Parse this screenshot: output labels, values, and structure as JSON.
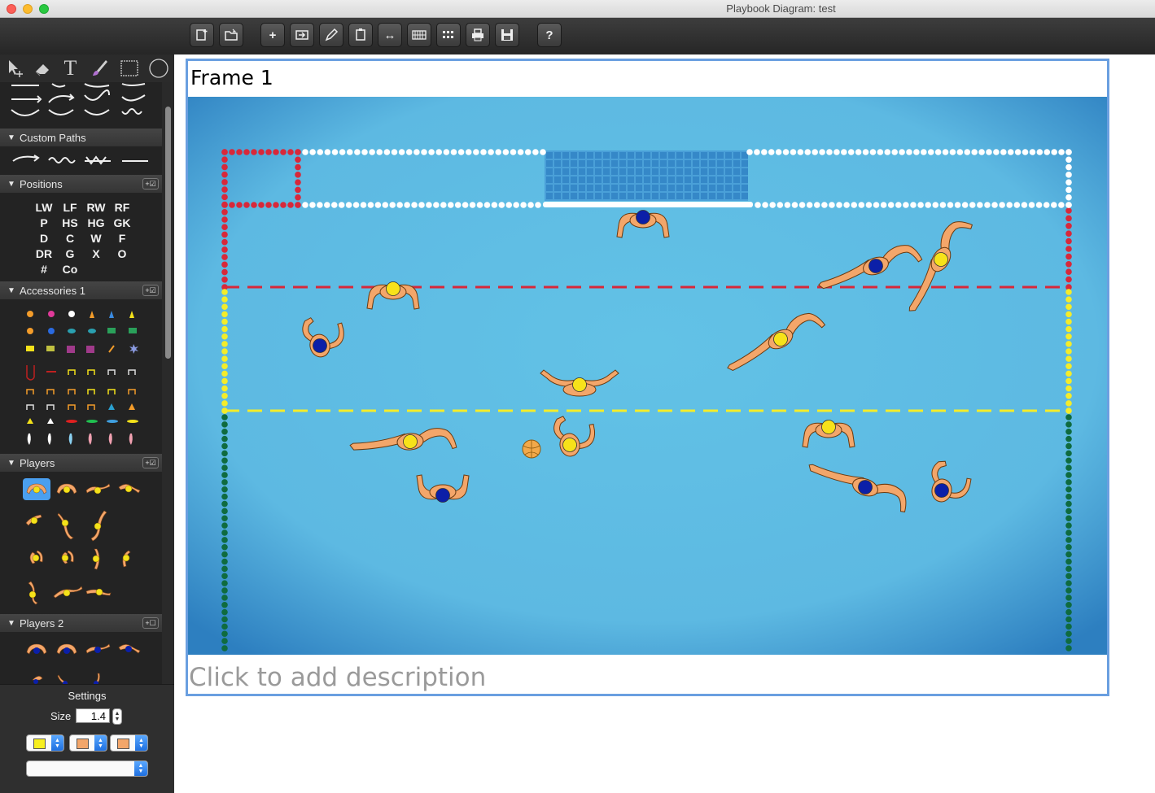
{
  "window": {
    "title": "Playbook Diagram: test"
  },
  "toolbar": {
    "buttons": [
      {
        "name": "new-frame-icon",
        "label": ""
      },
      {
        "name": "open-icon",
        "label": ""
      },
      {
        "name": "add-icon",
        "label": "+"
      },
      {
        "name": "export-icon",
        "label": ""
      },
      {
        "name": "pencil-icon",
        "label": ""
      },
      {
        "name": "paste-icon",
        "label": ""
      },
      {
        "name": "resize-icon",
        "label": "↔"
      },
      {
        "name": "grid-small-icon",
        "label": ""
      },
      {
        "name": "grid-large-icon",
        "label": ""
      },
      {
        "name": "print-icon",
        "label": ""
      },
      {
        "name": "save-icon",
        "label": ""
      },
      {
        "name": "help-icon",
        "label": "?"
      }
    ]
  },
  "tools": [
    "select-tool-icon",
    "eraser-icon",
    "text-tool-icon",
    "brush-icon",
    "rectangle-tool-icon",
    "ellipse-tool-icon"
  ],
  "tools_text": {
    "text_tool": "T"
  },
  "sections": {
    "custom_paths": "Custom Paths",
    "positions": "Positions",
    "accessories": "Accessories 1",
    "players": "Players",
    "players2": "Players 2"
  },
  "positions": [
    [
      "LW",
      "LF",
      "RW",
      "RF"
    ],
    [
      "P",
      "HS",
      "HG",
      "GK"
    ],
    [
      "D",
      "C",
      "W",
      "F"
    ],
    [
      "DR",
      "G",
      "X",
      "O"
    ],
    [
      "#",
      "Co"
    ]
  ],
  "settings": {
    "title": "Settings",
    "size_label": "Size",
    "size_value": "1.4",
    "colors": [
      "#f7ef1f",
      "#f3a66a",
      "#f3a66a"
    ]
  },
  "frame": {
    "title": "Frame 1",
    "description_placeholder": "Click to add description"
  },
  "colors": {
    "water": "#5cbde3",
    "cap_yellow": "#f7e21a",
    "cap_blue": "#0b1fa8",
    "skin": "#f3a66a",
    "lane_red": "#d8283a",
    "lane_yellow": "#f4ec2a",
    "lane_green": "#0f6b3f",
    "frame_border": "#6a9fe0"
  }
}
